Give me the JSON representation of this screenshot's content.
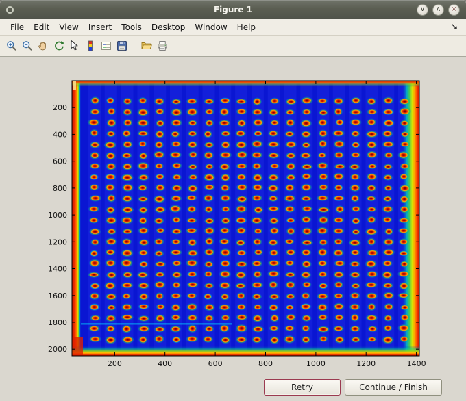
{
  "window": {
    "title": "Figure 1",
    "controls": [
      "minimize",
      "maximize",
      "close"
    ]
  },
  "menubar": {
    "items": [
      {
        "label": "File"
      },
      {
        "label": "Edit"
      },
      {
        "label": "View"
      },
      {
        "label": "Insert"
      },
      {
        "label": "Tools"
      },
      {
        "label": "Desktop"
      },
      {
        "label": "Window"
      },
      {
        "label": "Help"
      }
    ]
  },
  "toolbar": {
    "icons": [
      {
        "name": "zoom-in"
      },
      {
        "name": "zoom-out"
      },
      {
        "name": "pan-hand"
      },
      {
        "name": "rotate-3d"
      },
      {
        "name": "data-cursor"
      },
      {
        "name": "colorbar"
      },
      {
        "name": "insert-legend"
      },
      {
        "name": "save"
      },
      {
        "name": "open-folder"
      },
      {
        "name": "print"
      }
    ]
  },
  "dialog_buttons": {
    "retry_label": "Retry",
    "continue_label": "Continue / Finish"
  },
  "chart_data": {
    "type": "heatmap",
    "title": "",
    "colormap": "jet",
    "description": "False-color (jet colormap) intensity image of a scanned micro-well plate: a regular grid of hot red/orange spots with yellow-green halos on a deep blue background; the plate borders saturate red/orange, strongest along the left and right edges.",
    "x_ticks": [
      200,
      400,
      600,
      800,
      1000,
      1200,
      1400
    ],
    "y_ticks": [
      200,
      400,
      600,
      800,
      1000,
      1200,
      1400,
      1600,
      1800,
      2000
    ],
    "x_range": [
      30,
      1412
    ],
    "y_range": [
      0,
      2050
    ],
    "axes": {
      "box": true,
      "tick_direction": "in"
    },
    "spot_grid": {
      "cols": 20,
      "rows": 23,
      "x_first": 120,
      "x_last": 1352,
      "y_first": 152,
      "y_last": 1928,
      "spot_rx": 14,
      "spot_ry": 17
    },
    "colors": {
      "background": "#0a16d2",
      "spot_core": "#8a0000",
      "spot_mid": "#e23000",
      "spot_rim": "#ffb400",
      "halo_green": "#2fc83c",
      "edge_hot": "#c01000",
      "edge_warm": "#ff9c00"
    }
  }
}
